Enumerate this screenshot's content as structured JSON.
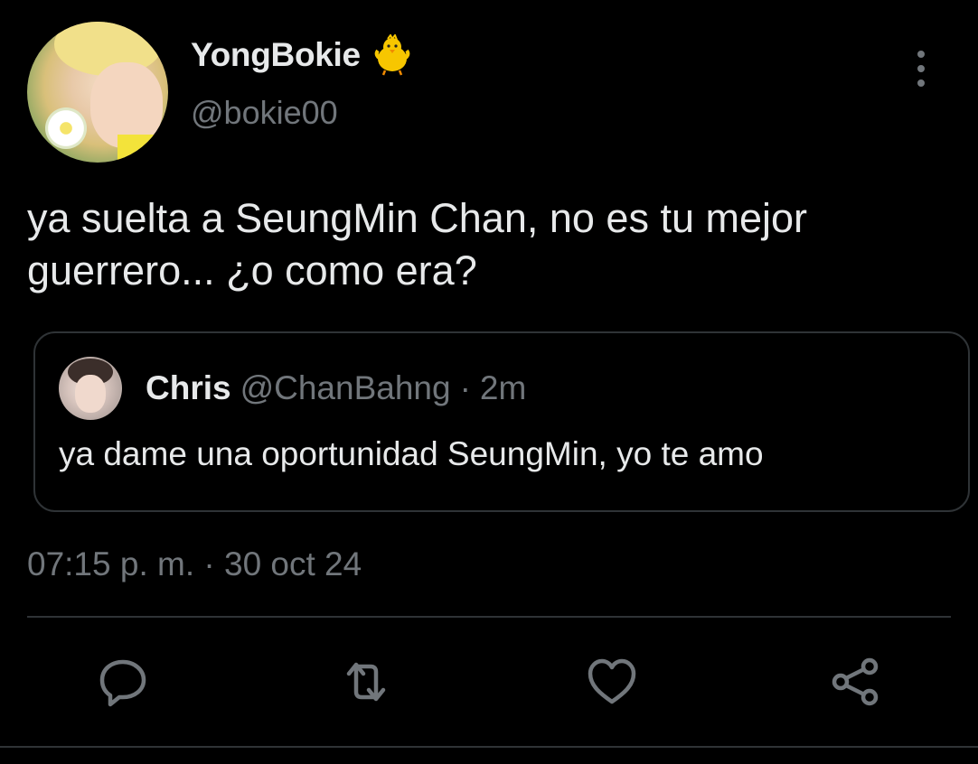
{
  "author": {
    "display_name": "YongBokie",
    "badge_icon": "chick-emoji-icon",
    "handle": "@bokie00"
  },
  "tweet": {
    "text": "ya suelta a SeungMin Chan, no es tu mejor guerrero... ¿o como era?"
  },
  "quoted_tweet": {
    "name": "Chris",
    "handle": "@ChanBahng",
    "separator": "·",
    "time": "2m",
    "text": "ya dame una oportunidad SeungMin, yo te amo"
  },
  "meta": {
    "timestamp": "07:15 p. m. · 30 oct 24"
  },
  "actions": [
    {
      "icon": "reply-icon"
    },
    {
      "icon": "retweet-icon"
    },
    {
      "icon": "like-icon"
    },
    {
      "icon": "share-icon"
    }
  ],
  "colors": {
    "background": "#000000",
    "text": "#e7e9ea",
    "muted": "#71767b",
    "border": "#2f3336"
  }
}
